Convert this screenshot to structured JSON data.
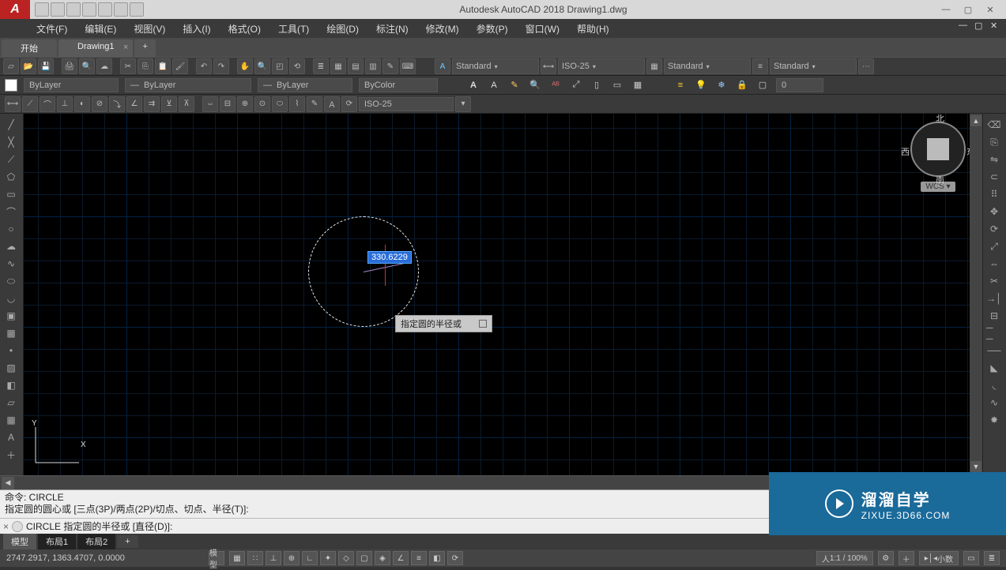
{
  "title": "Autodesk AutoCAD 2018    Drawing1.dwg",
  "app_logo": "A",
  "menus": [
    "文件(F)",
    "编辑(E)",
    "视图(V)",
    "插入(I)",
    "格式(O)",
    "工具(T)",
    "绘图(D)",
    "标注(N)",
    "修改(M)",
    "参数(P)",
    "窗口(W)",
    "帮助(H)"
  ],
  "doc_tabs": {
    "start": "开始",
    "drawing": "Drawing1",
    "plus": "+"
  },
  "styles": {
    "text": "Standard",
    "dim": "ISO-25",
    "table": "Standard",
    "ml": "Standard"
  },
  "layer_row": {
    "current_layer": "ByLayer",
    "l1": "ByLayer",
    "l2": "ByLayer",
    "l3": "ByColor",
    "layer_combo": "0",
    "light_combo": "0"
  },
  "dim_row": {
    "style": "ISO-25"
  },
  "viewcube": {
    "n": "北",
    "s": "南",
    "e": "东",
    "w": "西",
    "wcs": "WCS"
  },
  "drawing": {
    "dynamic_value": "330.6229",
    "prompt_tooltip": "指定圆的半径或"
  },
  "command": {
    "hist1": "命令: CIRCLE",
    "hist2": "指定圆的圆心或 [三点(3P)/两点(2P)/切点、切点、半径(T)]:",
    "line_icon": "▸",
    "line_text": "CIRCLE 指定圆的半径或 [直径(D)]:"
  },
  "model_tabs": {
    "model": "模型",
    "layout1": "布局1",
    "layout2": "布局2",
    "plus": "+"
  },
  "status": {
    "coords": "2747.2917, 1363.4707, 0.0000",
    "space": "模型",
    "scale": "1:1 / 100%",
    "units": "小数"
  },
  "watermark": {
    "title": "溜溜自学",
    "url": "ZIXUE.3D66.COM"
  }
}
